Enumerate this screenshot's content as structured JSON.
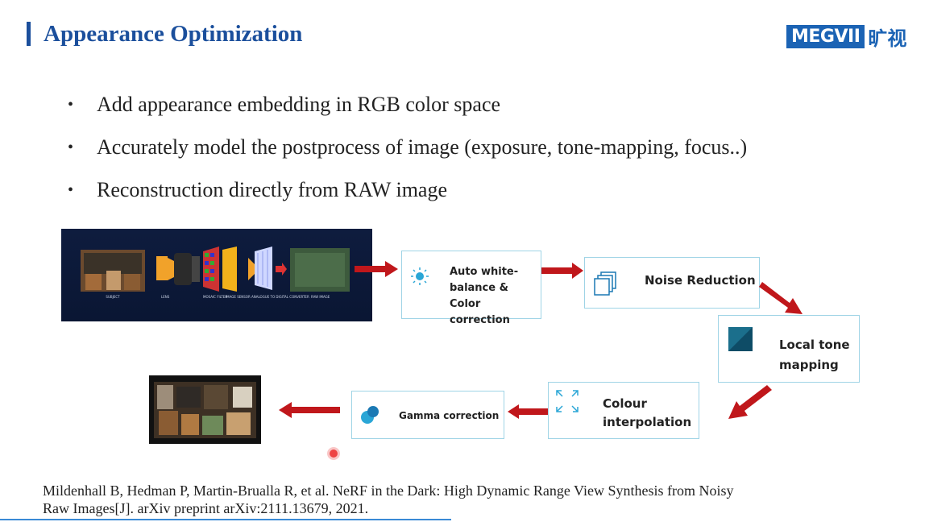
{
  "slide": {
    "title": "Appearance Optimization",
    "logo_text": "MEGVII",
    "logo_cn": "旷视",
    "bullets": [
      "Add appearance embedding in RGB color space",
      "Accurately model the postprocess of image (exposure, tone-mapping, focus..)",
      "Reconstruction directly from RAW image"
    ],
    "pipeline": {
      "camera_labels": [
        "SUBJECT",
        "LENS",
        "MOSAIC FILTER",
        "IMAGE SENSOR",
        "ANALOGUE TO DIGITAL CONVERTER",
        "RAW IMAGE"
      ],
      "steps": {
        "awb": "Auto white-balance & Color correction",
        "noise": "Noise Reduction",
        "tone": "Local tone mapping",
        "colour": "Colour interpolation",
        "gamma": "Gamma correction"
      }
    },
    "reference": {
      "line1": "Mildenhall B, Hedman P, Martin-Brualla R, et al. NeRF in the Dark: High Dynamic Range View Synthesis from Noisy",
      "line2": "Raw Images[J]. arXiv preprint arXiv:2111.13679, 2021."
    },
    "colors": {
      "accent": "#1b4f9c",
      "arrow": "#c0171b",
      "box_border": "#9fd4e6"
    }
  }
}
